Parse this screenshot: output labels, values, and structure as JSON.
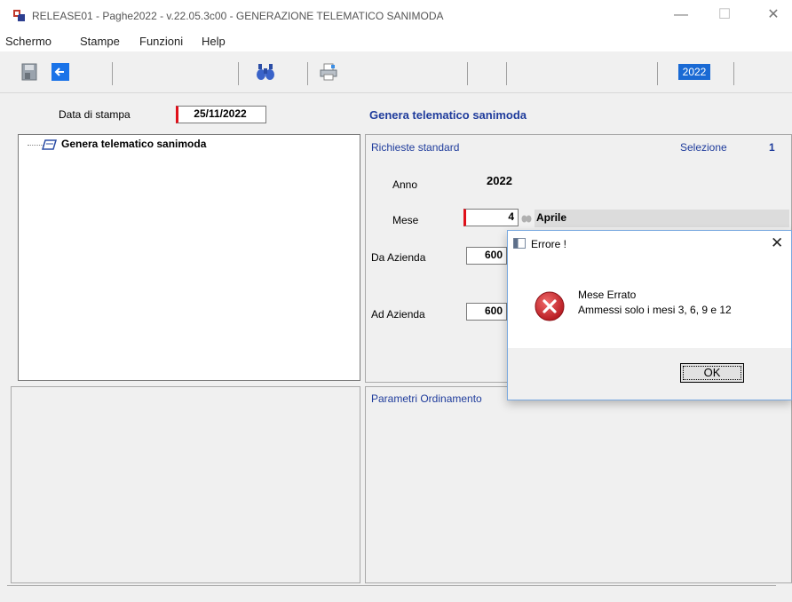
{
  "window": {
    "title": "RELEASE01 - Paghe2022 - v.22.05.3c00 - GENERAZIONE TELEMATICO SANIMODA",
    "minimize": "—",
    "maximize": "☐",
    "close": "✕"
  },
  "menu": [
    "Schermo",
    "Stampe",
    "Funzioni",
    "Help"
  ],
  "toolbar": {
    "year": "2022",
    "icons": [
      "save-icon",
      "back-arrow-icon",
      "binoculars-icon",
      "printer-icon"
    ]
  },
  "form": {
    "print_date_label": "Data di stampa",
    "print_date_value": "25/11/2022",
    "header_title": "Genera telematico sanimoda",
    "tree_item": "Genera telematico sanimoda",
    "standard_requests_label": "Richieste standard",
    "selection_label": "Selezione",
    "selection_value": "1",
    "year_label": "Anno",
    "year_value": "2022",
    "month_label": "Mese",
    "month_value": "4",
    "month_name": "Aprile",
    "from_company_label": "Da Azienda",
    "from_company_value": "600",
    "to_company_label": "Ad Azienda",
    "to_company_value": "600",
    "sort_params_label": "Parametri Ordinamento"
  },
  "dialog": {
    "title": "Errore !",
    "close": "✕",
    "line1": "Mese Errato",
    "line2": "Ammessi solo i mesi 3, 6, 9 e 12",
    "ok_label": "OK",
    "icon": "error-icon"
  },
  "colors": {
    "accent_blue": "#1a6ad4",
    "label_blue": "#1f3c9c",
    "required_red": "#e0101a",
    "error_red": "#d2202a"
  }
}
